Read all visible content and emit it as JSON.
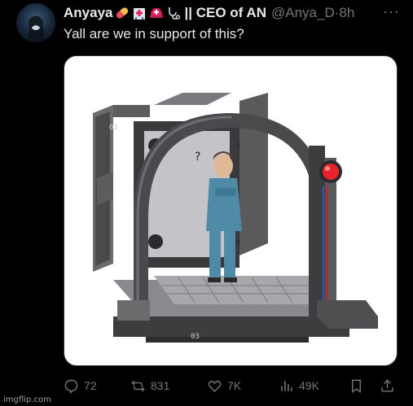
{
  "tweet": {
    "display_name": "Anyaya",
    "emojis": [
      "pill-emoji",
      "hospital-emoji",
      "rescue-helmet-emoji",
      "stethoscope-emoji"
    ],
    "title_text": "|| CEO of AN",
    "handle": "@Anya_D",
    "separator": "·",
    "time": "8h",
    "more_label": "···",
    "text": "Yall are we in support of this?"
  },
  "actions": {
    "replies": "72",
    "reposts": "831",
    "likes": "7K",
    "views": "49K"
  },
  "media": {
    "labels": [
      "03",
      "03",
      "03",
      "03"
    ]
  },
  "watermark": "imgflip.com"
}
